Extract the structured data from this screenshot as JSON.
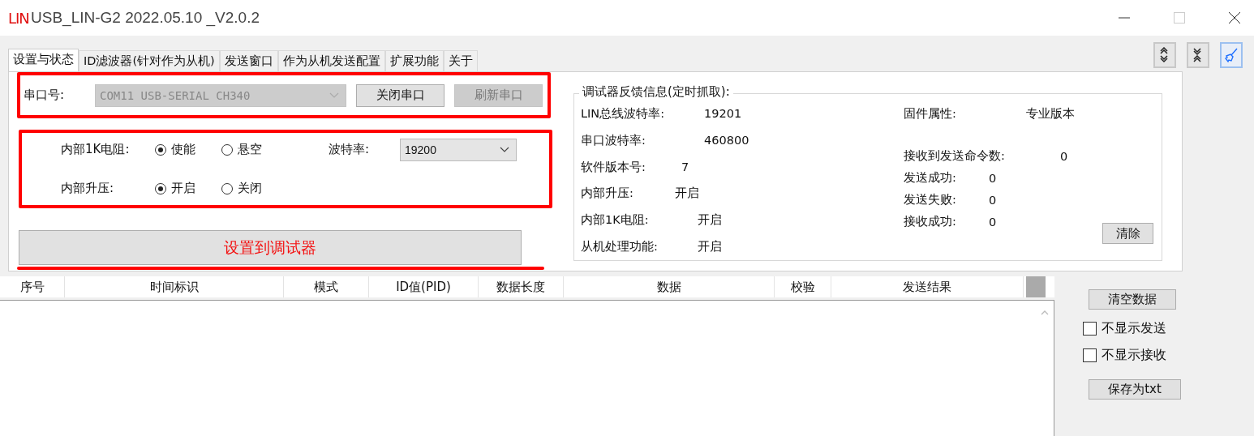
{
  "window": {
    "logo": "LIN",
    "title": "USB_LIN-G2 2022.05.10 _V2.0.2"
  },
  "tabs": [
    {
      "label": "设置与状态",
      "selected": true
    },
    {
      "label": "ID滤波器(针对作为从机)",
      "selected": false
    },
    {
      "label": "发送窗口",
      "selected": false
    },
    {
      "label": "作为从机发送配置",
      "selected": false
    },
    {
      "label": "扩展功能",
      "selected": false
    },
    {
      "label": "关于",
      "selected": false
    }
  ],
  "toolbar": [
    {
      "kind": "expand",
      "active": false
    },
    {
      "kind": "collapse",
      "active": false
    },
    {
      "kind": "brush",
      "active": true
    }
  ],
  "serial": {
    "label": "串口号:",
    "port": "COM11 USB-SERIAL CH340",
    "port_disabled": true,
    "buttons": [
      {
        "label": "关闭串口",
        "disabled": false
      },
      {
        "label": "刷新串口",
        "disabled": true
      }
    ]
  },
  "settings": {
    "groups": [
      {
        "label": "内部1K电阻:",
        "options": [
          {
            "label": "使能",
            "selected": true
          },
          {
            "label": "悬空",
            "selected": false
          }
        ]
      },
      {
        "label": "内部升压:",
        "options": [
          {
            "label": "开启",
            "selected": true
          },
          {
            "label": "关闭",
            "selected": false
          }
        ]
      }
    ],
    "baud_label": "波特率:",
    "baud_value": "19200"
  },
  "apply_button": "设置到调试器",
  "feedback": {
    "title": "调试器反馈信息(定时抓取):",
    "left": [
      {
        "label": "LIN总线波特率:",
        "value": "19201"
      },
      {
        "label": "串口波特率:",
        "value": "460800"
      },
      {
        "label": "软件版本号:",
        "value": "7"
      },
      {
        "label": "内部升压:",
        "value": "开启"
      },
      {
        "label": "内部1K电阻:",
        "value": "开启"
      },
      {
        "label": "从机处理功能:",
        "value": "开启"
      }
    ],
    "firmware": {
      "label": "固件属性:",
      "value": "专业版本"
    },
    "counters": [
      {
        "label": "接收到发送命令数:",
        "value": "0"
      },
      {
        "label": "发送成功:",
        "value": "0"
      },
      {
        "label": "发送失败:",
        "value": "0"
      },
      {
        "label": "接收成功:",
        "value": "0"
      }
    ],
    "clear_button": "清除"
  },
  "table": {
    "columns": [
      "序号",
      "时间标识",
      "模式",
      "ID值(PID)",
      "数据长度",
      "数据",
      "校验",
      "发送结果"
    ]
  },
  "side": {
    "clear_button": "清空数据",
    "checkboxes": [
      {
        "label": "不显示发送",
        "checked": false
      },
      {
        "label": "不显示接收",
        "checked": false
      }
    ],
    "save_button": "保存为txt"
  }
}
